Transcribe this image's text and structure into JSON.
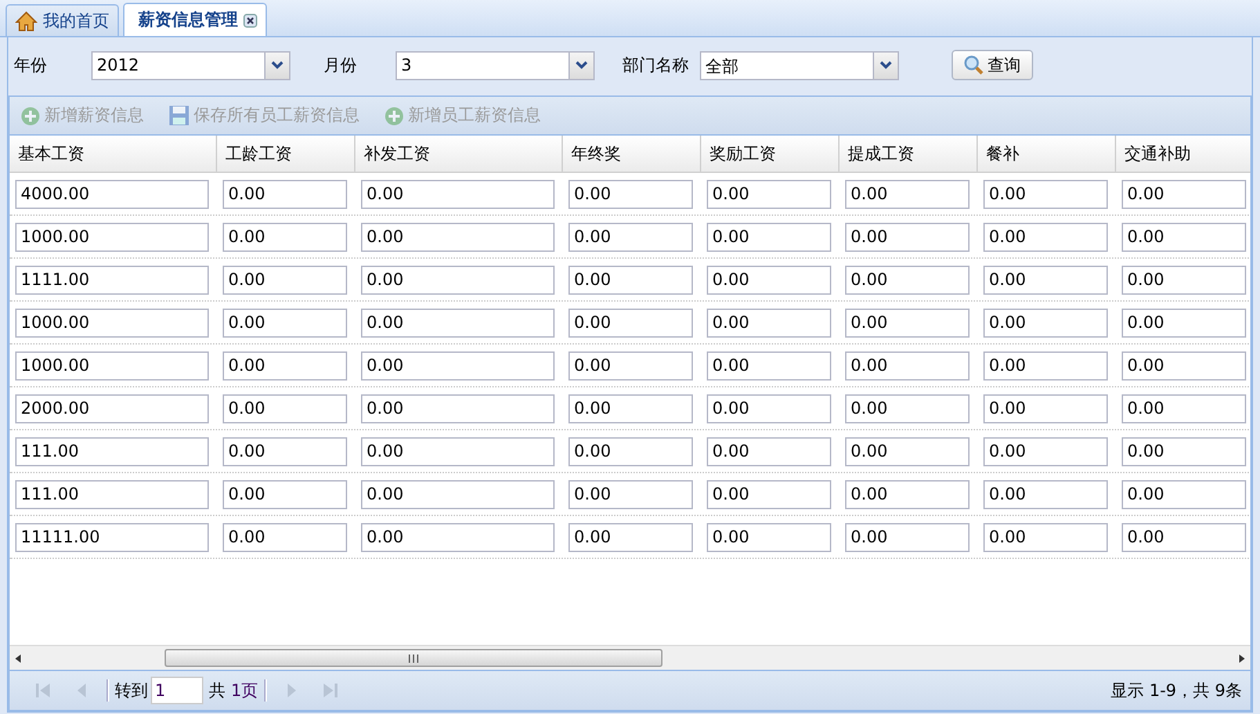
{
  "tabs": [
    {
      "label": "我的首页",
      "kind": "home",
      "selected": false
    },
    {
      "label": "薪资信息管理",
      "kind": "closable",
      "selected": true
    }
  ],
  "filters": [
    {
      "label": "年份",
      "value": "2012"
    },
    {
      "label": "月份",
      "value": "3"
    },
    {
      "label": "部门名称",
      "value": "全部"
    }
  ],
  "search_button": "查询",
  "toolbar": [
    {
      "label": "新增薪资信息",
      "kind": "add",
      "disabled": true
    },
    {
      "label": "保存所有员工薪资信息",
      "kind": "save",
      "disabled": true
    },
    {
      "label": "新增员工薪资信息",
      "kind": "add",
      "disabled": true
    }
  ],
  "table": {
    "columns": [
      "基本工资",
      "工龄工资",
      "补发工资",
      "年终奖",
      "奖励工资",
      "提成工资",
      "餐补",
      "交通补助"
    ],
    "rows": [
      [
        "4000.00",
        "0.00",
        "0.00",
        "0.00",
        "0.00",
        "0.00",
        "0.00",
        "0.00"
      ],
      [
        "1000.00",
        "0.00",
        "0.00",
        "0.00",
        "0.00",
        "0.00",
        "0.00",
        "0.00"
      ],
      [
        "1111.00",
        "0.00",
        "0.00",
        "0.00",
        "0.00",
        "0.00",
        "0.00",
        "0.00"
      ],
      [
        "1000.00",
        "0.00",
        "0.00",
        "0.00",
        "0.00",
        "0.00",
        "0.00",
        "0.00"
      ],
      [
        "1000.00",
        "0.00",
        "0.00",
        "0.00",
        "0.00",
        "0.00",
        "0.00",
        "0.00"
      ],
      [
        "2000.00",
        "0.00",
        "0.00",
        "0.00",
        "0.00",
        "0.00",
        "0.00",
        "0.00"
      ],
      [
        "111.00",
        "0.00",
        "0.00",
        "0.00",
        "0.00",
        "0.00",
        "0.00",
        "0.00"
      ],
      [
        "111.00",
        "0.00",
        "0.00",
        "0.00",
        "0.00",
        "0.00",
        "0.00",
        "0.00"
      ],
      [
        "11111.00",
        "0.00",
        "0.00",
        "0.00",
        "0.00",
        "0.00",
        "0.00",
        "0.00"
      ]
    ]
  },
  "pager": {
    "goto_label": "转到",
    "page_input": "1",
    "total_label": "共",
    "total_pages": "1页",
    "summary": "显示 1-9，共 9条"
  }
}
